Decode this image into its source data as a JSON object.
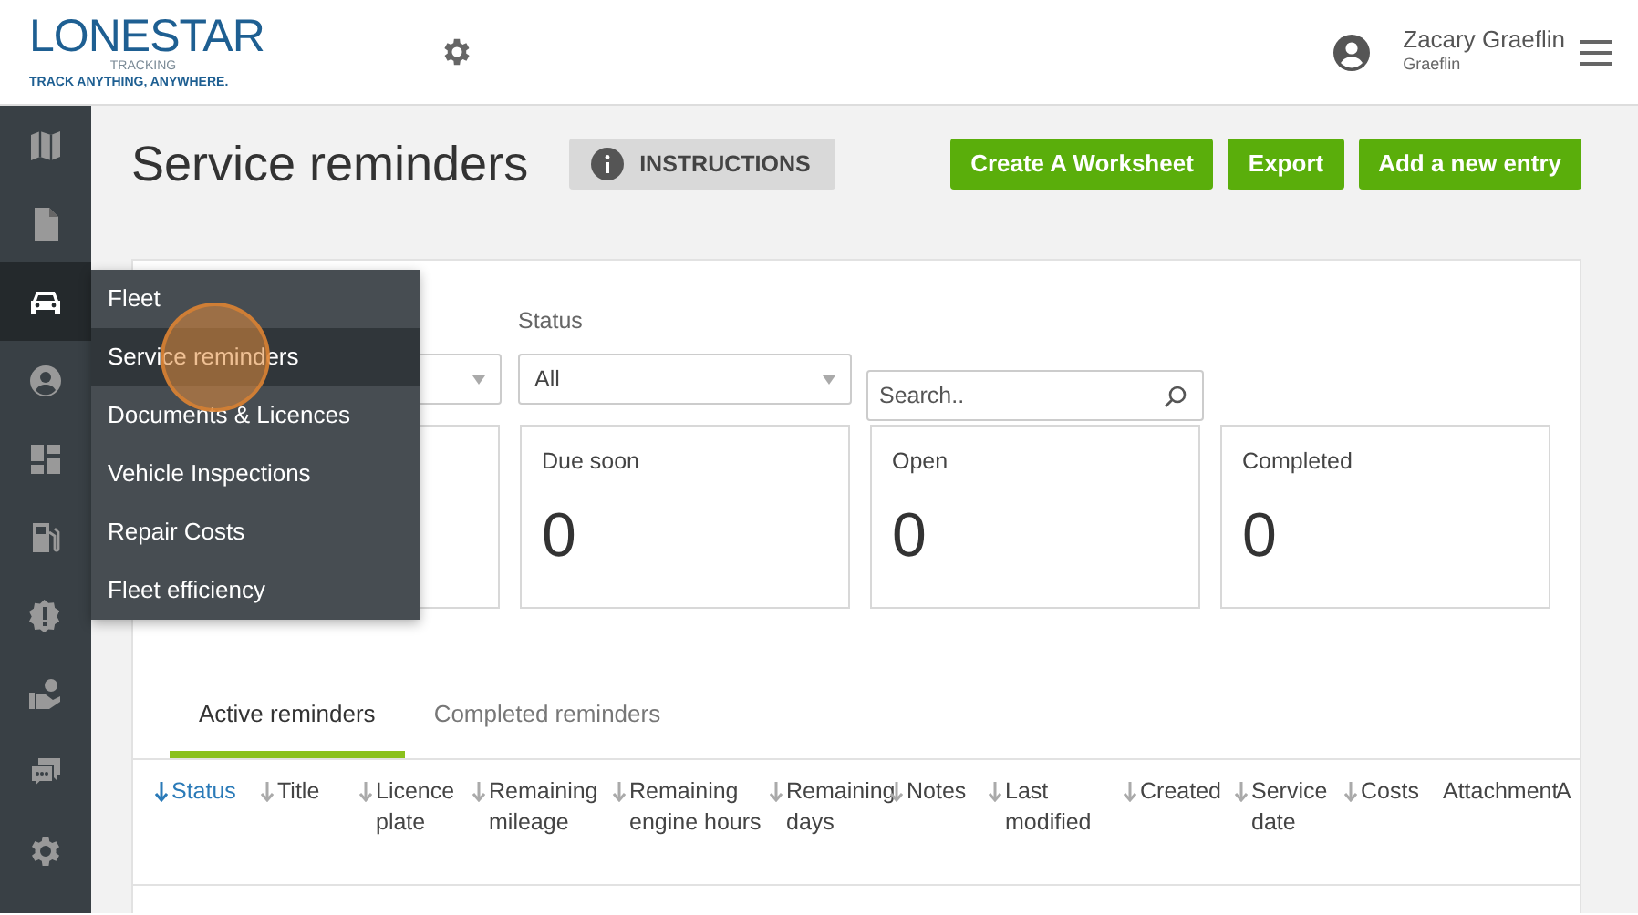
{
  "header": {
    "logo": {
      "name": "LONESTAR",
      "sub": "TRACKING",
      "tagline": "TRACK ANYTHING, ANYWHERE."
    },
    "user": {
      "name": "Zacary Graeflin",
      "account": "Graeflin"
    }
  },
  "sidebar": {
    "items": [
      {
        "kind": "map",
        "selected": false
      },
      {
        "kind": "file",
        "selected": false
      },
      {
        "kind": "car",
        "selected": true
      },
      {
        "kind": "user",
        "selected": false
      },
      {
        "kind": "dashboard",
        "selected": false
      },
      {
        "kind": "fuel",
        "selected": false
      },
      {
        "kind": "alert",
        "selected": false
      },
      {
        "kind": "hand",
        "selected": false
      },
      {
        "kind": "chat",
        "selected": false
      },
      {
        "kind": "gear",
        "selected": false
      }
    ]
  },
  "flyout": {
    "items": [
      {
        "label": "Fleet",
        "selected": false
      },
      {
        "label": "Service reminders",
        "selected": true
      },
      {
        "label": "Documents & Licences",
        "selected": false
      },
      {
        "label": "Vehicle Inspections",
        "selected": false
      },
      {
        "label": "Repair Costs",
        "selected": false
      },
      {
        "label": "Fleet efficiency",
        "selected": false
      }
    ]
  },
  "page": {
    "title": "Service reminders",
    "instructions": "INSTRUCTIONS",
    "actions": [
      "Create A Worksheet",
      "Export",
      "Add a new entry"
    ]
  },
  "filters": {
    "status_label": "Status",
    "status_value": "All",
    "search_placeholder": "Search.."
  },
  "stats": [
    {
      "label": "Due soon",
      "value": "0"
    },
    {
      "label": "Open",
      "value": "0"
    },
    {
      "label": "Completed",
      "value": "0"
    }
  ],
  "tabs": [
    {
      "label": "Active reminders",
      "selected": true
    },
    {
      "label": "Completed reminders",
      "selected": false
    }
  ],
  "columns": [
    {
      "label": "Status",
      "sortable": true,
      "sorted": true
    },
    {
      "label": "Title",
      "sortable": true,
      "sorted": false
    },
    {
      "label": "Licence plate",
      "sortable": true,
      "sorted": false
    },
    {
      "label": "Remaining mileage",
      "sortable": true,
      "sorted": false
    },
    {
      "label": "Remaining engine hours",
      "sortable": true,
      "sorted": false
    },
    {
      "label": "Remaining days",
      "sortable": true,
      "sorted": false
    },
    {
      "label": "Notes",
      "sortable": true,
      "sorted": false
    },
    {
      "label": "Last modified",
      "sortable": true,
      "sorted": false
    },
    {
      "label": "Created",
      "sortable": true,
      "sorted": false
    },
    {
      "label": "Service date",
      "sortable": true,
      "sorted": false
    },
    {
      "label": "Costs",
      "sortable": true,
      "sorted": false
    },
    {
      "label": "Attachment",
      "sortable": false,
      "sorted": false
    },
    {
      "label": "A",
      "sortable": false,
      "sorted": false
    }
  ]
}
